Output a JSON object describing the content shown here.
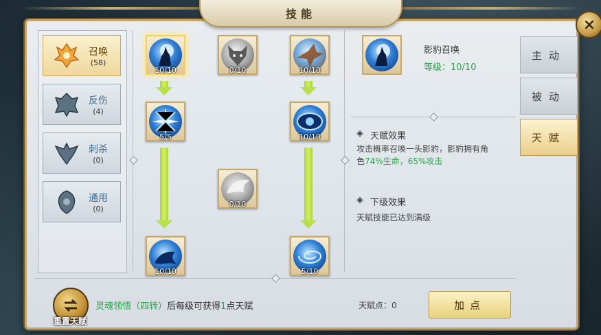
{
  "window": {
    "title": "技能",
    "close_label": "×"
  },
  "categories": [
    {
      "name": "召唤",
      "count": "(58)",
      "active": true
    },
    {
      "name": "反伤",
      "count": "(4)"
    },
    {
      "name": "刺杀",
      "count": "(0)"
    },
    {
      "name": "通用",
      "count": "(0)"
    }
  ],
  "tree": [
    {
      "icon": "wolf-howl-icon",
      "level": "10/10",
      "style": "blue",
      "selected": true
    },
    {
      "icon": "wolf-head-icon",
      "level": "0/10",
      "style": "gray"
    },
    {
      "icon": "eagle-icon",
      "level": "10/10",
      "style": "mixed"
    },
    {
      "icon": "star-burst-icon",
      "level": "5/5",
      "style": "blue"
    },
    {
      "icon": "eye-icon",
      "level": "10/10",
      "style": "blue"
    },
    {
      "icon": "wing-icon",
      "level": "0/10",
      "style": "gray"
    },
    {
      "icon": "blue-beast-icon",
      "level": "10/10",
      "style": "blue"
    },
    {
      "icon": "vortex-icon",
      "level": "5/10",
      "style": "blue"
    }
  ],
  "detail": {
    "skill_name": "影豹召唤",
    "level_text": "等级：10/10",
    "effect_title": "天赋效果",
    "effect_text_1": "攻击概率召唤一头影豹，影豹拥有角",
    "effect_text_2": "色",
    "effect_highlight": "74%生命，65%攻击",
    "next_title": "下级效果",
    "next_text": "天赋技能已达到满级"
  },
  "tabs": [
    {
      "label": "主动"
    },
    {
      "label": "被动"
    },
    {
      "label": "天赋",
      "active": true
    }
  ],
  "footer": {
    "reset_label": "重置天赋",
    "info_green": "灵魂领悟（四转）",
    "info_rest": "后每级可获得",
    "info_num": "1",
    "info_tail": "点天赋",
    "points_label": "天赋点：",
    "points_value": "0",
    "add_label": "加点"
  },
  "colors": {
    "accent_gold": "#c6a86a",
    "green": "#2aa24a",
    "arrow": "#b7e04c",
    "link_blue": "#3b6e96"
  }
}
